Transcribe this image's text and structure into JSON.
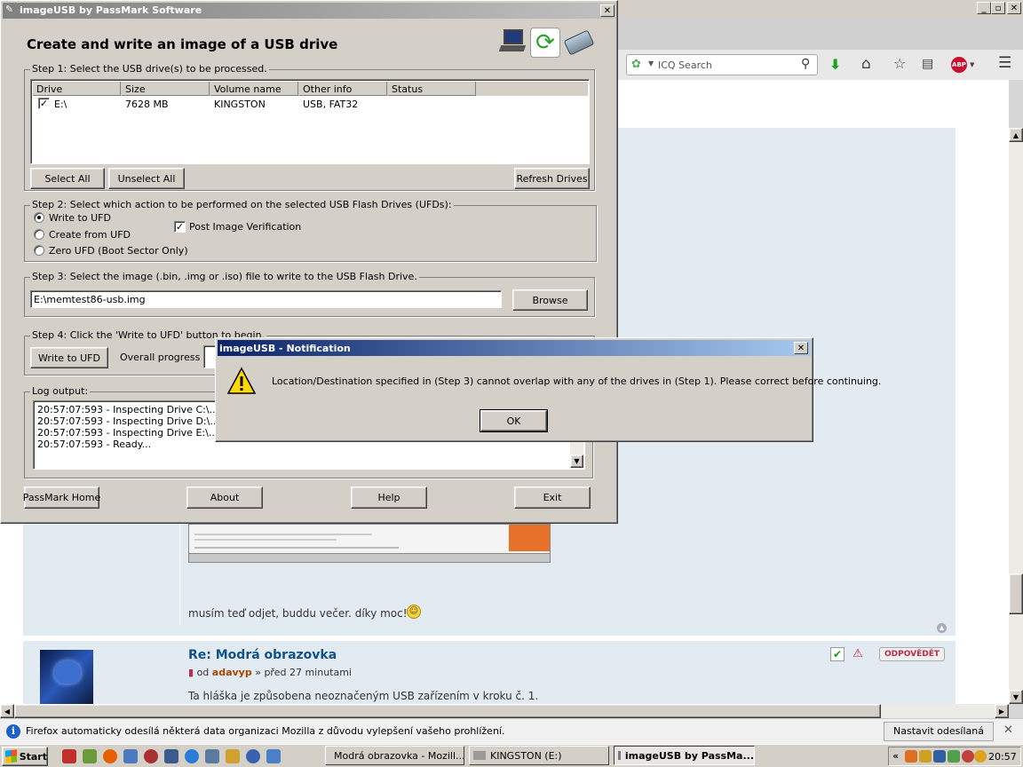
{
  "browser": {
    "search_placeholder": "ICQ Search",
    "post": {
      "text": "musím teď odjet, buddu večer. díky moc!",
      "reply_title": "Re: Modrá obrazovka",
      "meta_prefix": "od",
      "author": "adavyp",
      "meta_suffix": "» před 27 minutami",
      "reply_text": "Ta hláška je způsobena neoznačeným USB zařízením v kroku č. 1.",
      "reply_button": "ODPOVĚDĚT"
    },
    "notification": {
      "text": "Firefox automaticky odesílá některá data organizaci Mozilla z důvodu vylepšení vašeho prohlížení.",
      "button": "Nastavit odesílaná data"
    }
  },
  "app": {
    "title": "imageUSB by PassMark Software",
    "heading": "Create and write an image of a USB drive",
    "step1": {
      "legend": "Step 1: Select the USB drive(s) to be processed.",
      "columns": [
        "Drive",
        "Size",
        "Volume name",
        "Other info",
        "Status"
      ],
      "rows": [
        {
          "drive": "E:\\",
          "size": "7628 MB",
          "volume": "KINGSTON",
          "info": "USB, FAT32",
          "status": "",
          "checked": true
        }
      ],
      "select_all": "Select All",
      "unselect_all": "Unselect All",
      "refresh": "Refresh Drives"
    },
    "step2": {
      "legend": "Step 2: Select which action to be performed on the selected USB Flash Drives (UFDs):",
      "opt_write": "Write to UFD",
      "opt_create": "Create from UFD",
      "opt_zero": "Zero UFD (Boot Sector Only)",
      "verify": "Post Image Verification"
    },
    "step3": {
      "legend": "Step 3: Select the image (.bin, .img or .iso) file to write to the USB Flash Drive.",
      "path": "E:\\memtest86-usb.img",
      "browse": "Browse"
    },
    "step4": {
      "legend": "Step 4: Click the 'Write to UFD' button to begin.",
      "write": "Write to UFD",
      "progress_label": "Overall progress"
    },
    "log": {
      "legend": "Log output:",
      "lines": [
        "20:57:07:593 - Inspecting Drive C:\\...",
        "20:57:07:593 - Inspecting Drive D:\\...",
        "20:57:07:593 - Inspecting Drive E:\\...",
        "20:57:07:593 - Ready..."
      ]
    },
    "footer": {
      "home": "PassMark Home",
      "about": "About",
      "help": "Help",
      "exit": "Exit"
    }
  },
  "dialog": {
    "title": "imageUSB - Notification",
    "message": "Location/Destination specified in (Step 3) cannot overlap with any of the drives in (Step 1). Please correct before continuing.",
    "ok": "OK"
  },
  "taskbar": {
    "start": "Start",
    "tasks": [
      "Modrá obrazovka - Mozill...",
      "KINGSTON (E:)",
      "imageUSB by PassMa..."
    ],
    "clock": "20:57",
    "tray_arrows": "«"
  },
  "colors": {
    "titlebar": "#0a246a",
    "titlebar_end": "#a6caf0",
    "win_bg": "#d4d0c8",
    "page_bg": "#e3ebf2",
    "accent_red": "#bc2a4d",
    "link_blue": "#105289"
  }
}
